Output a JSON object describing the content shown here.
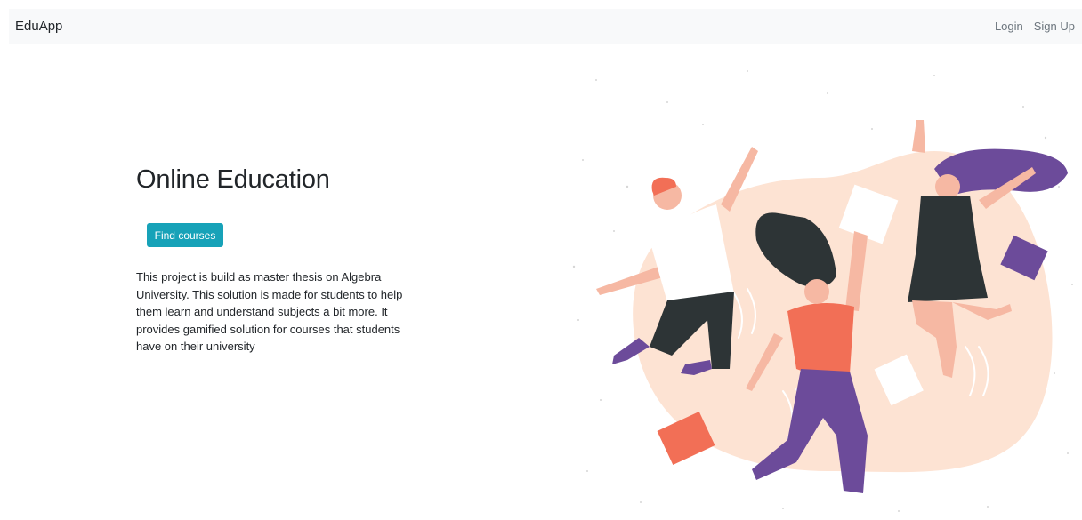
{
  "navbar": {
    "brand": "EduApp",
    "login_label": "Login",
    "signup_label": "Sign Up"
  },
  "hero": {
    "title": "Online Education",
    "cta_label": "Find courses",
    "description": "This project is build as master thesis on Algebra University. This solution is made for students to help them learn and understand subjects a bit more. It provides gamified solution for courses that students have on their university"
  },
  "illustration": {
    "name": "jumping-students-illustration",
    "colors": {
      "blob": "#fde3d3",
      "purple": "#6c4b9a",
      "orange": "#f26f56",
      "dark": "#2d3436",
      "skin": "#f6b8a3",
      "hair_red": "#f26f56"
    }
  },
  "colors": {
    "navbar_bg": "#f8f9fa",
    "button_bg": "#17a2b8",
    "text": "#212529",
    "muted": "#6c757d"
  }
}
